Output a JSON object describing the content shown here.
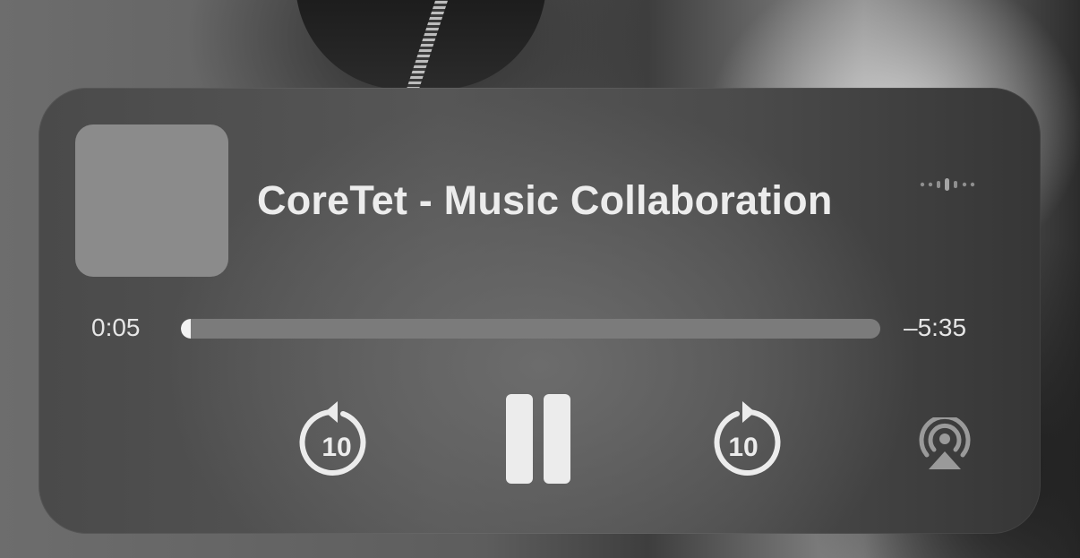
{
  "player": {
    "title": "CoreTet - Music Collaboration",
    "elapsed": "0:05",
    "remaining": "–5:35",
    "progress_fraction": 0.006,
    "controls": {
      "skip_back_seconds": "10",
      "skip_forward_seconds": "10",
      "playback_state": "playing",
      "skip_back_icon": "gobackward-10-icon",
      "pause_icon": "pause-icon",
      "skip_forward_icon": "goforward-10-icon",
      "airplay_icon": "airplay-audio-icon"
    },
    "waveform_icon": "waveform-icon"
  },
  "colors": {
    "card_background": "#4e4e4e",
    "text": "#ececec",
    "artwork_placeholder": "#8b8b8b",
    "progress_track": "#7b7b7b",
    "progress_fill": "#f2f2f2",
    "airplay_icon": "#9a9a9a"
  }
}
